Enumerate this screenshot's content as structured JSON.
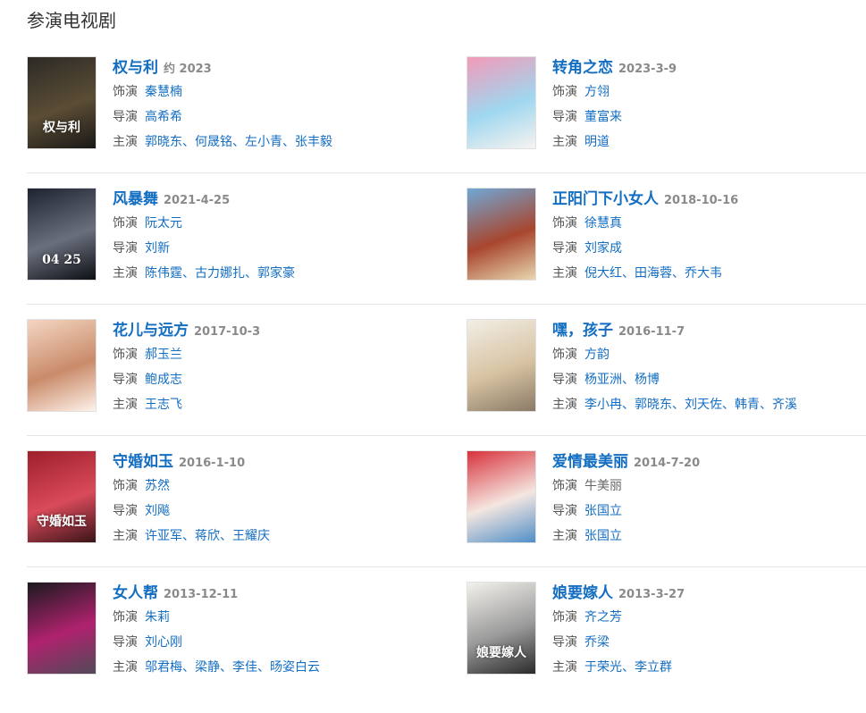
{
  "section": {
    "title": "参演电视剧"
  },
  "labels": {
    "role": "饰演",
    "director": "导演",
    "cast": "主演"
  },
  "works": [
    {
      "title": "权与利",
      "date": "约 2023",
      "role": "秦慧楠",
      "role_linked": true,
      "director": "高希希",
      "cast": "郭晓东、何晟铭、左小青、张丰毅",
      "poster": {
        "caption": "权与利",
        "colors": [
          "#2c2a26",
          "#5b4d35",
          "#1a1816"
        ]
      }
    },
    {
      "title": "转角之恋",
      "date": "2023-3-9",
      "role": "方翎",
      "role_linked": true,
      "director": "董富来",
      "cast": "明道",
      "poster": {
        "caption": "",
        "colors": [
          "#f39ab8",
          "#9fd7f0",
          "#f7f3f0"
        ]
      }
    },
    {
      "title": "风暴舞",
      "date": "2021-4-25",
      "role": "阮太元",
      "role_linked": true,
      "director": "刘新",
      "cast": "陈伟霆、古力娜扎、郭家豪",
      "poster": {
        "caption": "04 25",
        "colors": [
          "#1e2330",
          "#6a6f7d",
          "#0d0f14"
        ]
      }
    },
    {
      "title": "正阳门下小女人",
      "date": "2018-10-16",
      "role": "徐慧真",
      "role_linked": true,
      "director": "刘家成",
      "cast": "倪大红、田海蓉、乔大韦",
      "poster": {
        "caption": "",
        "colors": [
          "#6fa8d6",
          "#a8462e",
          "#e8d8b0"
        ]
      }
    },
    {
      "title": "花儿与远方",
      "date": "2017-10-3",
      "role": "郝玉兰",
      "role_linked": true,
      "director": "鲍成志",
      "cast": "王志飞",
      "poster": {
        "caption": "",
        "colors": [
          "#f4d6c2",
          "#c98b6a",
          "#fff2ea"
        ]
      }
    },
    {
      "title": "嘿，孩子",
      "date": "2016-11-7",
      "role": "方韵",
      "role_linked": true,
      "director": "杨亚洲、杨博",
      "cast": "李小冉、郭晓东、刘天佐、韩青、齐溪",
      "poster": {
        "caption": "",
        "colors": [
          "#f2eee6",
          "#d7c3a2",
          "#8a7a66"
        ]
      }
    },
    {
      "title": "守婚如玉",
      "date": "2016-1-10",
      "role": "苏然",
      "role_linked": true,
      "director": "刘飚",
      "cast": "许亚军、蒋欣、王耀庆",
      "poster": {
        "caption": "守婚如玉",
        "colors": [
          "#9e1f2c",
          "#d94a5a",
          "#3a1418"
        ]
      }
    },
    {
      "title": "爱情最美丽",
      "date": "2014-7-20",
      "role": "牛美丽",
      "role_linked": false,
      "director": "张国立",
      "cast": "张国立",
      "poster": {
        "caption": "",
        "colors": [
          "#d8323c",
          "#f5e6e0",
          "#4f8fc8"
        ]
      }
    },
    {
      "title": "女人帮",
      "date": "2013-12-11",
      "role": "朱莉",
      "role_linked": true,
      "director": "刘心刚",
      "cast": "邬君梅、梁静、李佳、旸姿白云",
      "poster": {
        "caption": "",
        "colors": [
          "#1a1a1f",
          "#b0226e",
          "#504a58"
        ]
      }
    },
    {
      "title": "娘要嫁人",
      "date": "2013-3-27",
      "role": "齐之芳",
      "role_linked": true,
      "director": "乔梁",
      "cast": "于荣光、李立群",
      "poster": {
        "caption": "娘要嫁人",
        "colors": [
          "#f3f1ec",
          "#9a9a9a",
          "#2a2a2a"
        ]
      }
    }
  ]
}
